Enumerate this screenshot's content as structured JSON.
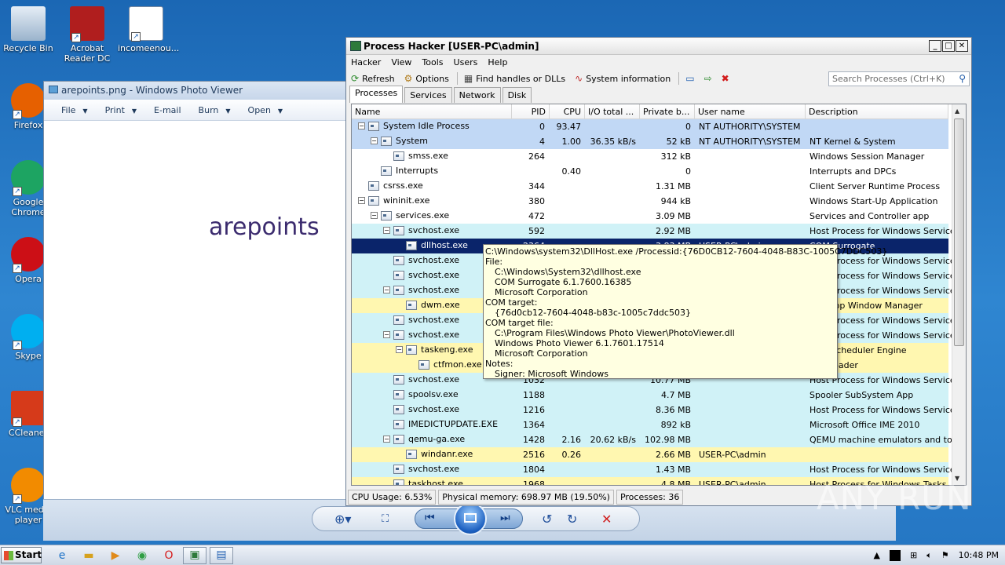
{
  "desktop": {
    "icons": [
      {
        "label": "Recycle Bin",
        "icon": "recycle-bin-icon"
      },
      {
        "label": "Acrobat Reader DC",
        "icon": "acrobat-icon"
      },
      {
        "label": "incomeenou...",
        "icon": "word-doc-icon"
      },
      {
        "label": "Firefox",
        "icon": "firefox-icon"
      },
      {
        "label": "Google Chrome",
        "icon": "chrome-icon"
      },
      {
        "label": "Opera",
        "icon": "opera-icon"
      },
      {
        "label": "Skype",
        "icon": "skype-icon"
      },
      {
        "label": "CCleaner",
        "icon": "ccleaner-icon"
      },
      {
        "label": "VLC media player",
        "icon": "vlc-icon"
      }
    ]
  },
  "photo_viewer": {
    "title": "arepoints.png - Windows Photo Viewer",
    "menu": [
      "File",
      "Print",
      "E-mail",
      "Burn",
      "Open"
    ],
    "image_text": "arepoints"
  },
  "process_hacker": {
    "title": "Process Hacker [USER-PC\\admin]",
    "menu": [
      "Hacker",
      "View",
      "Tools",
      "Users",
      "Help"
    ],
    "toolbar": {
      "refresh": "Refresh",
      "options": "Options",
      "find": "Find handles or DLLs",
      "sysinfo": "System information"
    },
    "search_placeholder": "Search Processes (Ctrl+K)",
    "tabs": [
      "Processes",
      "Services",
      "Network",
      "Disk"
    ],
    "columns": [
      "Name",
      "PID",
      "CPU",
      "I/O total ...",
      "Private b...",
      "User name",
      "Description"
    ],
    "rows": [
      {
        "name": "System Idle Process",
        "pid": "0",
        "cpu": "93.47",
        "io": "",
        "priv": "0",
        "user": "NT AUTHORITY\\SYSTEM",
        "desc": "",
        "bg": "#c1d8f5",
        "indent": 0,
        "exp": "−"
      },
      {
        "name": "System",
        "pid": "4",
        "cpu": "1.00",
        "io": "36.35 kB/s",
        "priv": "52 kB",
        "user": "NT AUTHORITY\\SYSTEM",
        "desc": "NT Kernel & System",
        "bg": "#c1d8f5",
        "indent": 1,
        "exp": "−"
      },
      {
        "name": "smss.exe",
        "pid": "264",
        "cpu": "",
        "io": "",
        "priv": "312 kB",
        "user": "",
        "desc": "Windows Session Manager",
        "bg": "#ffffff",
        "indent": 2,
        "exp": ""
      },
      {
        "name": "Interrupts",
        "pid": "",
        "cpu": "0.40",
        "io": "",
        "priv": "0",
        "user": "",
        "desc": "Interrupts and DPCs",
        "bg": "#ffffff",
        "indent": 1,
        "exp": ""
      },
      {
        "name": "csrss.exe",
        "pid": "344",
        "cpu": "",
        "io": "",
        "priv": "1.31 MB",
        "user": "",
        "desc": "Client Server Runtime Process",
        "bg": "#ffffff",
        "indent": 0,
        "exp": ""
      },
      {
        "name": "wininit.exe",
        "pid": "380",
        "cpu": "",
        "io": "",
        "priv": "944 kB",
        "user": "",
        "desc": "Windows Start-Up Application",
        "bg": "#ffffff",
        "indent": 0,
        "exp": "−"
      },
      {
        "name": "services.exe",
        "pid": "472",
        "cpu": "",
        "io": "",
        "priv": "3.09 MB",
        "user": "",
        "desc": "Services and Controller app",
        "bg": "#ffffff",
        "indent": 1,
        "exp": "−"
      },
      {
        "name": "svchost.exe",
        "pid": "592",
        "cpu": "",
        "io": "",
        "priv": "2.92 MB",
        "user": "",
        "desc": "Host Process for Windows Services",
        "bg": "#d0f2f7",
        "indent": 2,
        "exp": "−"
      },
      {
        "name": "dllhost.exe",
        "pid": "2364",
        "cpu": "",
        "io": "",
        "priv": "3.83 MB",
        "user": "USER-PC\\admin",
        "desc": "COM Surrogate",
        "bg": "#0a246a",
        "fg": "#ffffff",
        "indent": 3,
        "exp": ""
      },
      {
        "name": "svchost.exe",
        "pid": "",
        "cpu": "",
        "io": "",
        "priv": "",
        "user": "",
        "desc": "Host Process for Windows Services",
        "bg": "#d0f2f7",
        "indent": 2,
        "exp": ""
      },
      {
        "name": "svchost.exe",
        "pid": "",
        "cpu": "",
        "io": "",
        "priv": "",
        "user": "",
        "desc": "Host Process for Windows Services",
        "bg": "#d0f2f7",
        "indent": 2,
        "exp": ""
      },
      {
        "name": "svchost.exe",
        "pid": "",
        "cpu": "",
        "io": "",
        "priv": "",
        "user": "",
        "desc": "Host Process for Windows Services",
        "bg": "#d0f2f7",
        "indent": 2,
        "exp": "−"
      },
      {
        "name": "dwm.exe",
        "pid": "",
        "cpu": "",
        "io": "",
        "priv": "",
        "user": "",
        "desc": "Desktop Window Manager",
        "bg": "#fff7b0",
        "indent": 3,
        "exp": ""
      },
      {
        "name": "svchost.exe",
        "pid": "",
        "cpu": "",
        "io": "",
        "priv": "",
        "user": "",
        "desc": "Host Process for Windows Services",
        "bg": "#d0f2f7",
        "indent": 2,
        "exp": ""
      },
      {
        "name": "svchost.exe",
        "pid": "",
        "cpu": "",
        "io": "",
        "priv": "",
        "user": "",
        "desc": "Host Process for Windows Services",
        "bg": "#d0f2f7",
        "indent": 2,
        "exp": "−"
      },
      {
        "name": "taskeng.exe",
        "pid": "",
        "cpu": "",
        "io": "",
        "priv": "",
        "user": "",
        "desc": "Task Scheduler Engine",
        "bg": "#fff7b0",
        "indent": 3,
        "exp": "−"
      },
      {
        "name": "ctfmon.exe",
        "pid": "",
        "cpu": "",
        "io": "",
        "priv": "",
        "user": "",
        "desc": "CTF Loader",
        "bg": "#fff7b0",
        "indent": 4,
        "exp": ""
      },
      {
        "name": "svchost.exe",
        "pid": "1032",
        "cpu": "",
        "io": "",
        "priv": "10.77 MB",
        "user": "",
        "desc": "Host Process for Windows Services",
        "bg": "#d0f2f7",
        "indent": 2,
        "exp": ""
      },
      {
        "name": "spoolsv.exe",
        "pid": "1188",
        "cpu": "",
        "io": "",
        "priv": "4.7 MB",
        "user": "",
        "desc": "Spooler SubSystem App",
        "bg": "#d0f2f7",
        "indent": 2,
        "exp": ""
      },
      {
        "name": "svchost.exe",
        "pid": "1216",
        "cpu": "",
        "io": "",
        "priv": "8.36 MB",
        "user": "",
        "desc": "Host Process for Windows Services",
        "bg": "#d0f2f7",
        "indent": 2,
        "exp": ""
      },
      {
        "name": "IMEDICTUPDATE.EXE",
        "pid": "1364",
        "cpu": "",
        "io": "",
        "priv": "892 kB",
        "user": "",
        "desc": "Microsoft Office IME 2010",
        "bg": "#d0f2f7",
        "indent": 2,
        "exp": ""
      },
      {
        "name": "qemu-ga.exe",
        "pid": "1428",
        "cpu": "2.16",
        "io": "20.62 kB/s",
        "priv": "102.98 MB",
        "user": "",
        "desc": "QEMU machine emulators and tools",
        "bg": "#d0f2f7",
        "indent": 2,
        "exp": "−"
      },
      {
        "name": "windanr.exe",
        "pid": "2516",
        "cpu": "0.26",
        "io": "",
        "priv": "2.66 MB",
        "user": "USER-PC\\admin",
        "desc": "",
        "bg": "#fff7b0",
        "indent": 3,
        "exp": ""
      },
      {
        "name": "svchost.exe",
        "pid": "1804",
        "cpu": "",
        "io": "",
        "priv": "1.43 MB",
        "user": "",
        "desc": "Host Process for Windows Services",
        "bg": "#d0f2f7",
        "indent": 2,
        "exp": ""
      },
      {
        "name": "taskhost.exe",
        "pid": "1968",
        "cpu": "",
        "io": "",
        "priv": "4.8 MB",
        "user": "USER-PC\\admin",
        "desc": "Host Process for Windows Tasks",
        "bg": "#fff7b0",
        "indent": 2,
        "exp": ""
      }
    ],
    "status": {
      "cpu": "CPU Usage: 6.53%",
      "mem": "Physical memory: 698.97 MB (19.50%)",
      "procs": "Processes: 36"
    }
  },
  "tooltip": [
    {
      "text": "C:\\Windows\\system32\\DllHost.exe /Processid:{76D0CB12-7604-4048-B83C-1005C7DDC503}",
      "ind": false
    },
    {
      "text": "File:",
      "ind": false
    },
    {
      "text": "C:\\Windows\\System32\\dllhost.exe",
      "ind": true
    },
    {
      "text": "COM Surrogate 6.1.7600.16385",
      "ind": true
    },
    {
      "text": "Microsoft Corporation",
      "ind": true
    },
    {
      "text": "COM target:",
      "ind": false
    },
    {
      "text": "{76d0cb12-7604-4048-b83c-1005c7ddc503}",
      "ind": true
    },
    {
      "text": "COM target file:",
      "ind": false
    },
    {
      "text": "C:\\Program Files\\Windows Photo Viewer\\PhotoViewer.dll",
      "ind": true
    },
    {
      "text": "Windows Photo Viewer 6.1.7601.17514",
      "ind": true
    },
    {
      "text": "Microsoft Corporation",
      "ind": true
    },
    {
      "text": "Notes:",
      "ind": false
    },
    {
      "text": "Signer: Microsoft Windows",
      "ind": true
    }
  ],
  "watermark": "ANY RUN",
  "taskbar": {
    "start": "Start",
    "clock": "10:48 PM"
  }
}
